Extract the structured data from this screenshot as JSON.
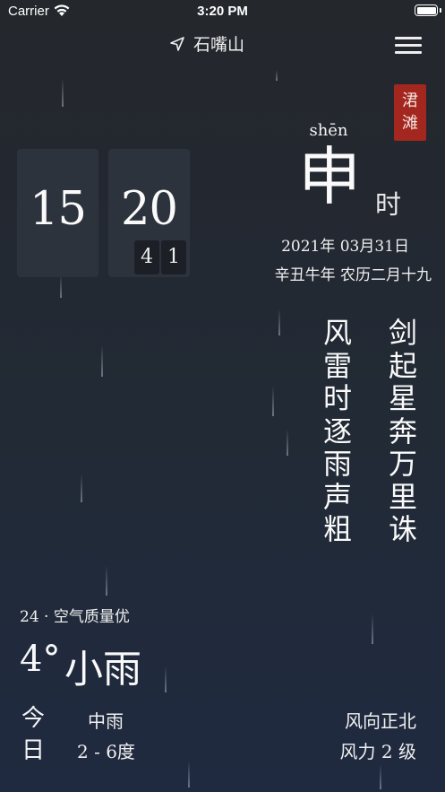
{
  "status_bar": {
    "carrier": "Carrier",
    "time": "3:20 PM"
  },
  "nav": {
    "location": "石嘴山",
    "location_icon": "location-arrow-icon",
    "menu_icon": "hamburger-menu-icon"
  },
  "clock": {
    "hour": "15",
    "minute": "20",
    "second_tens": "4",
    "second_ones": "1"
  },
  "stamp": {
    "line1": "涒",
    "line2": "滩"
  },
  "shichen": {
    "pinyin": "shēn",
    "char": "申",
    "suffix": "时"
  },
  "date": {
    "gregorian": "2021年 03月31日",
    "lunar": "辛丑牛年 农历二月十九"
  },
  "poem": {
    "column_right": [
      "剑",
      "起",
      "星",
      "奔",
      "万",
      "里",
      "诛"
    ],
    "column_left": [
      "风",
      "雷",
      "时",
      "逐",
      "雨",
      "声",
      "粗"
    ]
  },
  "weather": {
    "aqi": "24 · 空气质量优",
    "temperature": "4°",
    "condition": "小雨",
    "today_label": [
      "今",
      "日"
    ],
    "forecast_condition": "中雨",
    "forecast_range": "2 - 6度",
    "wind_direction": "风向正北",
    "wind_strength": "风力 2 级"
  },
  "colors": {
    "background_top": "#24272c",
    "background_bottom": "#1f2a40",
    "stamp": "#a3261f",
    "card": "#2d333d"
  }
}
